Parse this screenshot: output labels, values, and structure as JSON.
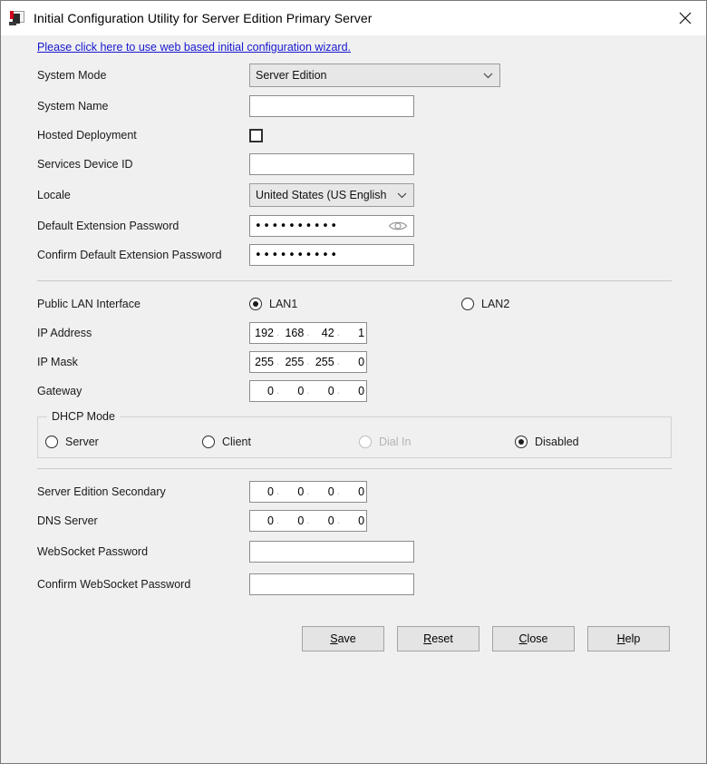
{
  "window": {
    "title": "Initial Configuration Utility for Server Edition Primary Server",
    "app_icon": "app-icon",
    "close_icon": "close-icon",
    "background_color": "#f0f0f0",
    "titlebar_color": "#ffffff"
  },
  "link": {
    "text": "Please click here to use web based initial configuration wizard.",
    "color": "#1818d0"
  },
  "general": {
    "system_mode": {
      "label": "System Mode",
      "value": "Server Edition",
      "options": [
        "Server Edition"
      ]
    },
    "system_name": {
      "label": "System Name",
      "value": "",
      "placeholder": ""
    },
    "hosted_deployment": {
      "label": "Hosted Deployment",
      "checked": false
    },
    "services_device_id": {
      "label": "Services Device ID",
      "value": "",
      "placeholder": ""
    },
    "locale": {
      "label": "Locale",
      "value": "United States (US English",
      "options": [
        "United States (US English"
      ]
    },
    "default_extension_password": {
      "label": "Default Extension Password",
      "value": "••••••••••",
      "reveal_icon": "eye-icon"
    },
    "confirm_default_extension_password": {
      "label": "Confirm Default Extension Password",
      "value": "••••••••••"
    }
  },
  "network": {
    "public_lan_interface": {
      "label": "Public LAN Interface",
      "selected": "LAN1",
      "options": [
        {
          "label": "LAN1",
          "selected": true
        },
        {
          "label": "LAN2",
          "selected": false
        }
      ]
    },
    "ip_address": {
      "label": "IP Address",
      "octets": [
        "192",
        "168",
        "42",
        "1"
      ]
    },
    "ip_mask": {
      "label": "IP Mask",
      "octets": [
        "255",
        "255",
        "255",
        "0"
      ]
    },
    "gateway": {
      "label": "Gateway",
      "octets": [
        "0",
        "0",
        "0",
        "0"
      ]
    },
    "dhcp_mode": {
      "label": "DHCP Mode",
      "selected": "Disabled",
      "options": [
        {
          "label": "Server",
          "selected": false,
          "disabled": false
        },
        {
          "label": "Client",
          "selected": false,
          "disabled": false
        },
        {
          "label": "Dial In",
          "selected": false,
          "disabled": true
        },
        {
          "label": "Disabled",
          "selected": true,
          "disabled": false
        }
      ]
    }
  },
  "services": {
    "server_edition_secondary": {
      "label": "Server Edition Secondary",
      "octets": [
        "0",
        "0",
        "0",
        "0"
      ]
    },
    "dns_server": {
      "label": "DNS Server",
      "octets": [
        "0",
        "0",
        "0",
        "0"
      ]
    },
    "websocket_password": {
      "label": "WebSocket Password",
      "value": "",
      "placeholder": ""
    },
    "confirm_websocket_password": {
      "label": "Confirm WebSocket Password",
      "value": "",
      "placeholder": ""
    }
  },
  "buttons": [
    {
      "label": "Save",
      "mnemonic": "S"
    },
    {
      "label": "Reset",
      "mnemonic": "R"
    },
    {
      "label": "Close",
      "mnemonic": "C"
    },
    {
      "label": "Help",
      "mnemonic": "H"
    }
  ]
}
